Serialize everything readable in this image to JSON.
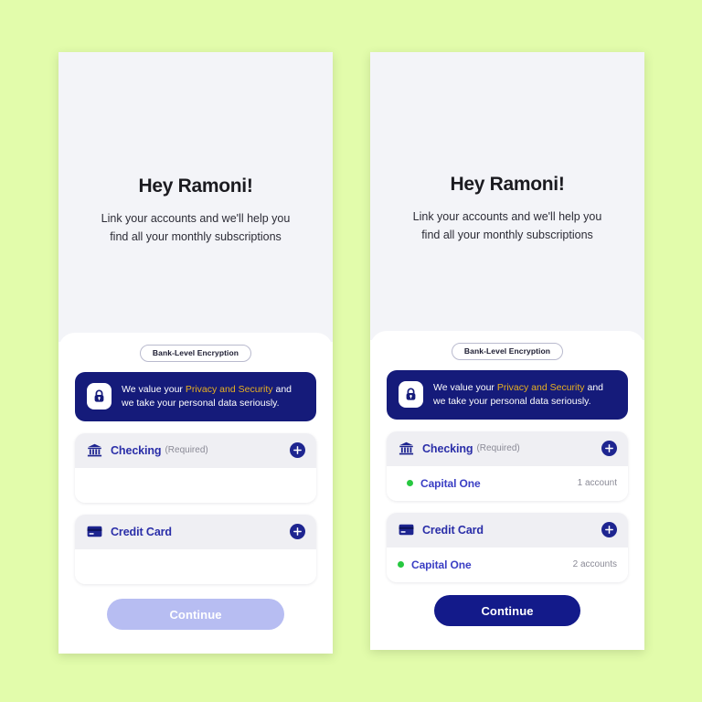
{
  "background_color": "#e2fcab",
  "theme": {
    "navy": "#151b7a",
    "accent_gold": "#e8b020",
    "indigo_text": "#2a2ea8",
    "green_dot": "#27c840",
    "hero_bg": "#f3f4f8",
    "card_head_bg": "#efeff3",
    "cta_disabled": "#b7bdf2",
    "cta_enabled": "#131a8a"
  },
  "hero": {
    "title": "Hey Ramoni!",
    "subtitle": "Link your accounts and we'll help you find all your monthly subscriptions"
  },
  "security": {
    "pill_label": "Bank-Level Encryption",
    "banner_prefix": "We value your ",
    "banner_highlight": "Privacy and Security",
    "banner_suffix": " and we take your personal data seriously."
  },
  "screens": [
    {
      "id": "empty-state",
      "cards": [
        {
          "icon": "bank-icon",
          "title": "Checking",
          "required_label": "(Required)",
          "add_label": "+",
          "accounts": []
        },
        {
          "icon": "credit-card-icon",
          "title": "Credit Card",
          "required_label": "",
          "add_label": "+",
          "accounts": []
        }
      ],
      "cta": {
        "label": "Continue",
        "state": "disabled"
      }
    },
    {
      "id": "linked-state",
      "cards": [
        {
          "icon": "bank-icon",
          "title": "Checking",
          "required_label": "(Required)",
          "add_label": "+",
          "accounts": [
            {
              "name": "Capital One",
              "count": "1 account",
              "status": "connected"
            }
          ]
        },
        {
          "icon": "credit-card-icon",
          "title": "Credit Card",
          "required_label": "",
          "add_label": "+",
          "accounts": [
            {
              "name": "Capital One",
              "count": "2 accounts",
              "status": "connected"
            }
          ]
        }
      ],
      "cta": {
        "label": "Continue",
        "state": "enabled"
      }
    }
  ]
}
